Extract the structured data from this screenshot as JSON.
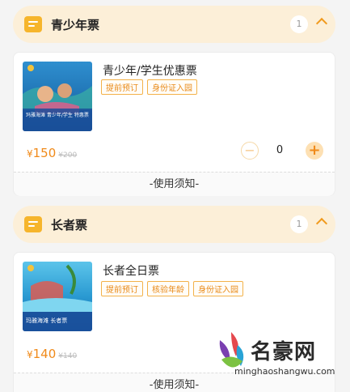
{
  "colors": {
    "accent": "#f6b52c",
    "price": "#f08a1a",
    "header_bg": "#fcefd8"
  },
  "sections": [
    {
      "title": "青少年票",
      "count": "1",
      "ticket": {
        "name": "青少年/学生优惠票",
        "image_caption": "玛雅海滩 青少年/学生 特惠票",
        "tags": [
          "提前预订",
          "身份证入园"
        ],
        "price_symbol": "¥",
        "price": "150",
        "original_price": "¥200",
        "quantity": "0",
        "notice": "-使用须知-"
      }
    },
    {
      "title": "长者票",
      "count": "1",
      "ticket": {
        "name": "长者全日票",
        "image_caption": "玛雅海滩 长者票",
        "tags": [
          "提前预订",
          "核验年龄",
          "身份证入园"
        ],
        "price_symbol": "¥",
        "price": "140",
        "original_price": "¥140",
        "notice": "-使用须知-"
      }
    }
  ],
  "watermark": {
    "brand": "名豪网",
    "url": "minghaoshangwu.com"
  }
}
